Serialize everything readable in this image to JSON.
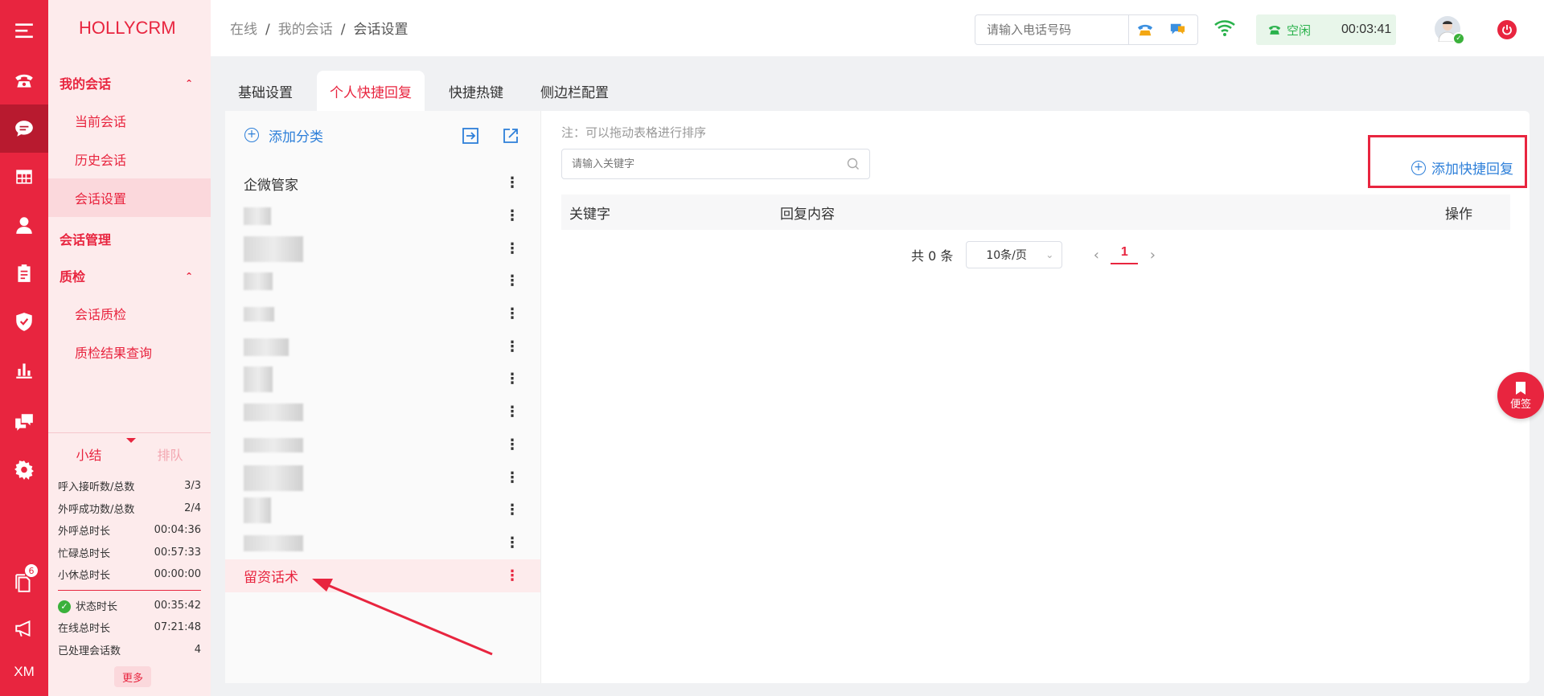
{
  "app": {
    "logo": "HOLLYCRM"
  },
  "rail": {
    "badge_count": "6",
    "user_initials": "XM",
    "accent": "#e8253f"
  },
  "nav": {
    "groups": [
      {
        "label": "我的会话",
        "items": [
          "当前会话",
          "历史会话",
          "会话设置"
        ]
      },
      {
        "label": "会话管理"
      },
      {
        "label": "质检",
        "items": [
          "会话质检",
          "质检结果查询"
        ]
      }
    ]
  },
  "summary": {
    "tab_summary": "小结",
    "tab_queue": "排队",
    "rows": [
      {
        "label": "呼入接听数/总数",
        "value": "3/3"
      },
      {
        "label": "外呼成功数/总数",
        "value": "2/4"
      },
      {
        "label": "外呼总时长",
        "value": "00:04:36"
      },
      {
        "label": "忙碌总时长",
        "value": "00:57:33"
      },
      {
        "label": "小休总时长",
        "value": "00:00:00"
      }
    ],
    "rows2": [
      {
        "label": "状态时长",
        "value": "00:35:42"
      },
      {
        "label": "在线总时长",
        "value": "07:21:48"
      },
      {
        "label": "已处理会话数",
        "value": "4"
      }
    ],
    "more": "更多"
  },
  "header": {
    "breadcrumb": [
      "在线",
      "我的会话",
      "会话设置"
    ],
    "phone_placeholder": "请输入电话号码",
    "status_label": "空闲",
    "status_time": "00:03:41",
    "status_color": "#2ab24c"
  },
  "tabs": [
    "基础设置",
    "个人快捷回复",
    "快捷热键",
    "侧边栏配置"
  ],
  "categories": {
    "add_label": "添加分类",
    "first": "企微管家",
    "blurred_rows": 11,
    "active": "留资话术"
  },
  "main": {
    "note": "注：可以拖动表格进行排序",
    "search_placeholder": "请输入关键字",
    "add_reply": "添加快捷回复",
    "columns": {
      "keyword": "关键字",
      "content": "回复内容",
      "action": "操作"
    },
    "pager": {
      "total": "共 0 条",
      "page_size": "10条/页",
      "current": "1"
    }
  },
  "float_note": "便签"
}
